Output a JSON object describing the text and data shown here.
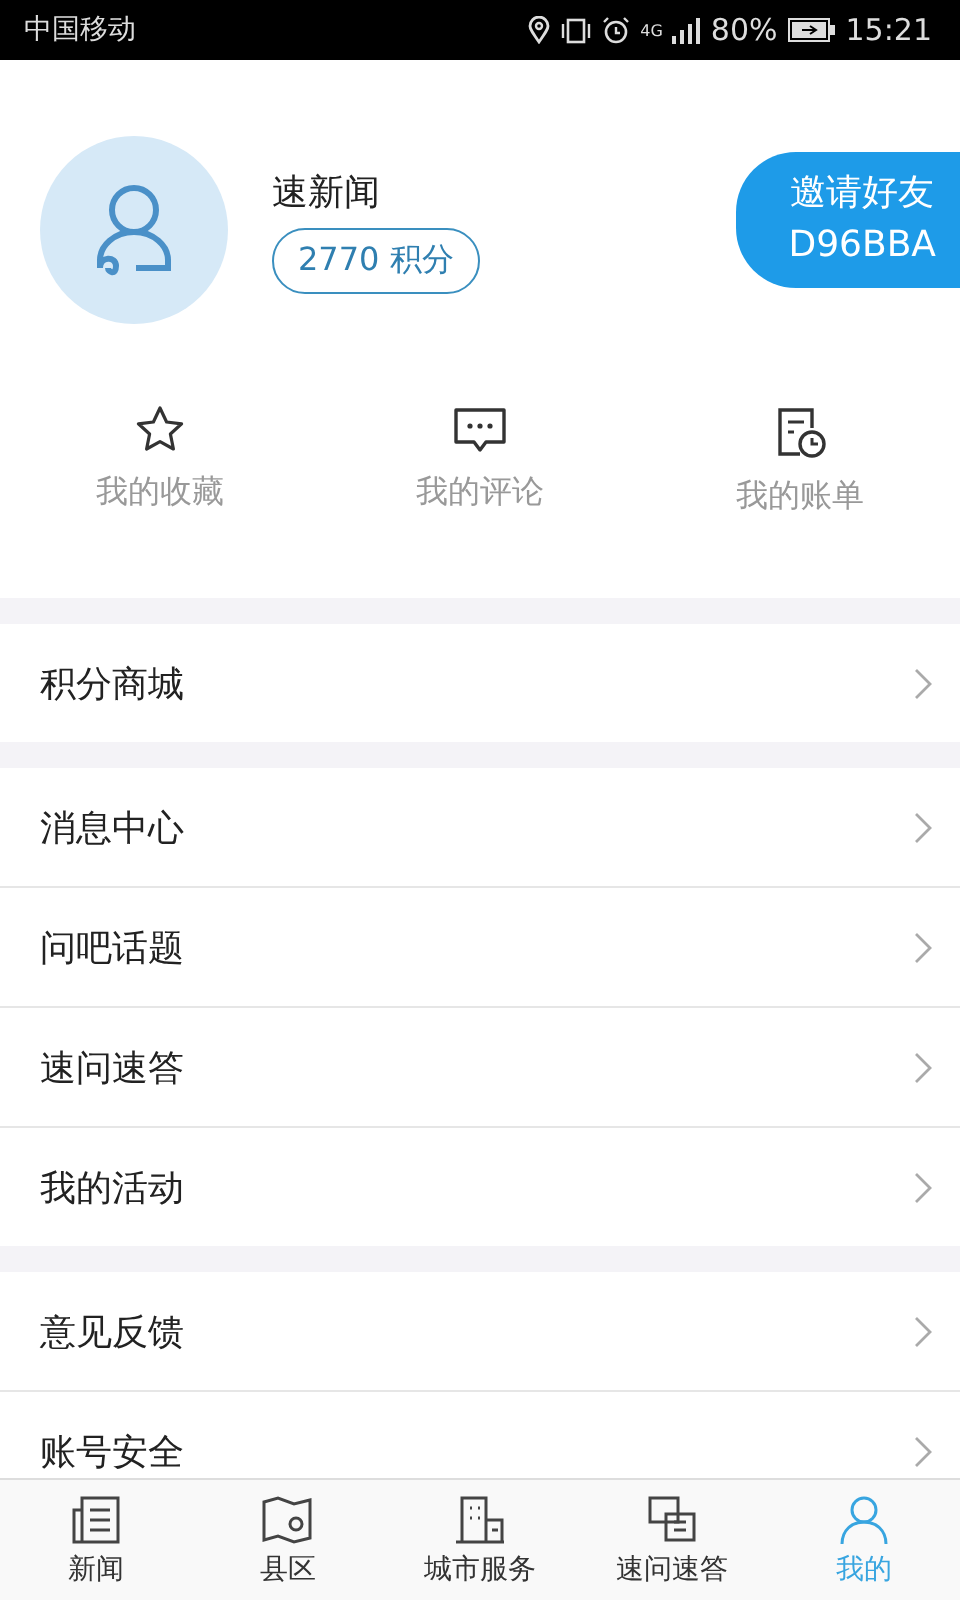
{
  "status_bar": {
    "carrier": "中国移动",
    "network": "4G",
    "battery": "80%",
    "time": "15:21"
  },
  "profile": {
    "name": "速新闻",
    "points": "2770 积分",
    "invite_label": "邀请好友",
    "invite_code": "D96BBA"
  },
  "shortcuts": [
    {
      "kind": "star",
      "label": "我的收藏"
    },
    {
      "kind": "comment",
      "label": "我的评论"
    },
    {
      "kind": "bill",
      "label": "我的账单"
    }
  ],
  "menu_groups": [
    {
      "items": [
        "积分商城"
      ]
    },
    {
      "items": [
        "消息中心",
        "问吧话题",
        "速问速答",
        "我的活动"
      ]
    },
    {
      "items": [
        "意见反馈",
        "账号安全"
      ]
    }
  ],
  "tabs": [
    {
      "kind": "news",
      "label": "新闻",
      "selected": false
    },
    {
      "kind": "map",
      "label": "县区",
      "selected": false
    },
    {
      "kind": "building",
      "label": "城市服务",
      "selected": false
    },
    {
      "kind": "qa",
      "label": "速问速答",
      "selected": false
    },
    {
      "kind": "person",
      "label": "我的",
      "selected": true
    }
  ]
}
